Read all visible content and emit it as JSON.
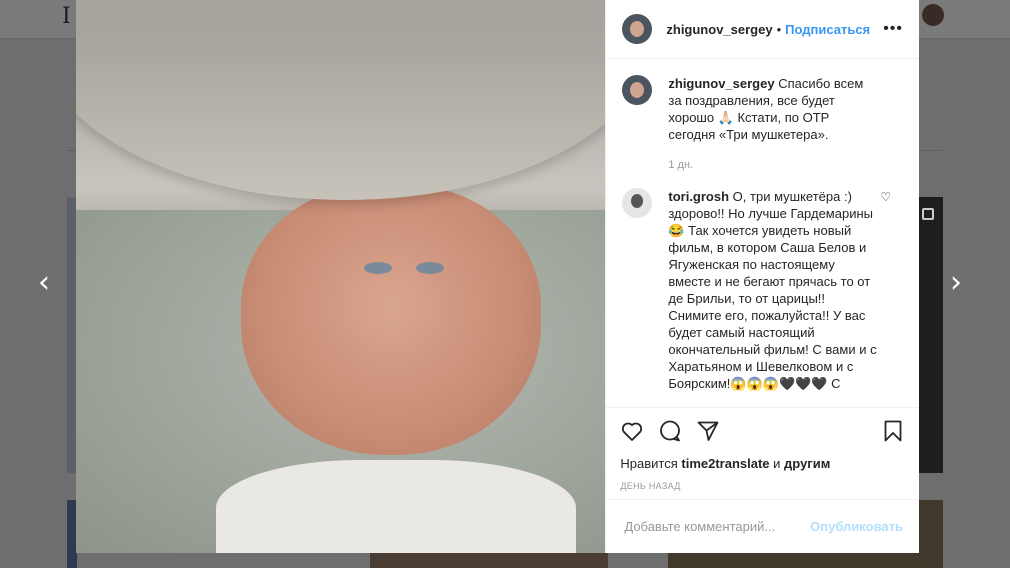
{
  "background": {
    "logo_text": "I"
  },
  "nav": {
    "prev": "‹",
    "next": "›"
  },
  "post": {
    "author": "zhigunov_sergey",
    "separator": "•",
    "follow_label": "Подписаться",
    "more": "•••"
  },
  "caption": {
    "username": "zhigunov_sergey",
    "text": "Спасибо всем за поздравления, все будет хорошо 🙏🏻 Кстати, по ОТР сегодня «Три мушкетера».",
    "time": "1 дн."
  },
  "comments": [
    {
      "username": "tori.grosh",
      "text": "О, три мушкетёра :) здорово!! Но лучше Гардемарины 😂 Так хочется увидеть новый фильм, в котором Саша Белов и Ягуженская по настоящему вместе и не бегают прячась то от де Брильи, то от царицы!! Снимите его, пожалуйста!! У вас будет самый настоящий окончательный фильм! С вами и с Харатьяном и Шевелковом и с Боярским!😱😱😱🖤🖤🖤 С"
    }
  ],
  "likes": {
    "prefix": "Нравится",
    "user": "time2translate",
    "middle": "и",
    "others": "другим"
  },
  "date": "ДЕНЬ НАЗАД",
  "add_comment": {
    "placeholder": "Добавьте комментарий...",
    "publish": "Опубликовать"
  }
}
